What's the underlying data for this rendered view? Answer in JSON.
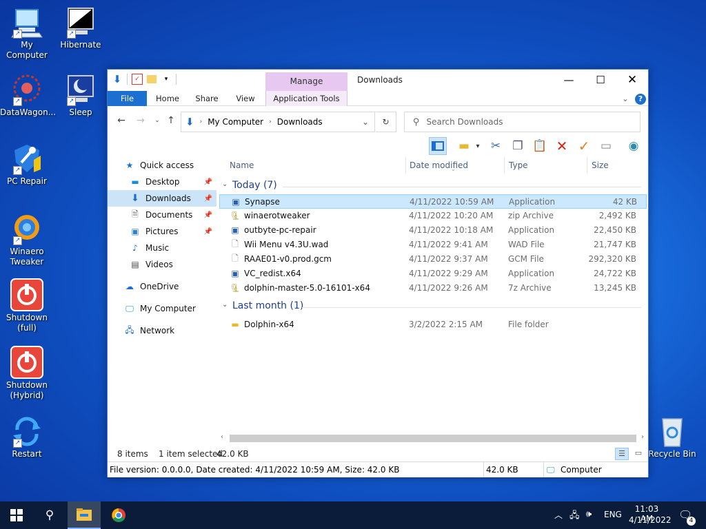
{
  "desktop": {
    "icons": [
      {
        "label": "My Computer"
      },
      {
        "label": "Hibernate"
      },
      {
        "label": "DataWagon..."
      },
      {
        "label": "Sleep"
      },
      {
        "label": "PC Repair"
      },
      {
        "label": "Winaero\nTweaker"
      },
      {
        "label": "Shutdown\n(full)"
      },
      {
        "label": "Shutdown\n(Hybrid)"
      },
      {
        "label": "Restart"
      },
      {
        "label": "Recycle Bin"
      }
    ]
  },
  "window": {
    "title": "Downloads",
    "context_tab": "Manage",
    "ribbon_tabs": [
      "File",
      "Home",
      "Share",
      "View",
      "Application Tools"
    ],
    "address": {
      "root": "My Computer",
      "current": "Downloads"
    },
    "search_placeholder": "Search Downloads"
  },
  "nav": {
    "items": [
      {
        "label": "Quick access",
        "icon": "star-icon"
      },
      {
        "label": "Desktop",
        "icon": "desktop-icon",
        "pinned": true
      },
      {
        "label": "Downloads",
        "icon": "download-icon",
        "pinned": true,
        "selected": true
      },
      {
        "label": "Documents",
        "icon": "documents-icon",
        "pinned": true
      },
      {
        "label": "Pictures",
        "icon": "pictures-icon",
        "pinned": true
      },
      {
        "label": "Music",
        "icon": "music-icon"
      },
      {
        "label": "Videos",
        "icon": "videos-icon"
      },
      {
        "label": "OneDrive",
        "icon": "cloud-icon"
      },
      {
        "label": "My Computer",
        "icon": "computer-icon"
      },
      {
        "label": "Network",
        "icon": "network-icon"
      }
    ]
  },
  "columns": {
    "name": "Name",
    "date": "Date modified",
    "type": "Type",
    "size": "Size"
  },
  "groups": [
    {
      "label": "Today (7)",
      "files": [
        {
          "name": "Synapse",
          "date": "4/11/2022 10:59 AM",
          "type": "Application",
          "size": "42 KB",
          "icon": "app-icon",
          "selected": true
        },
        {
          "name": "winaerotweaker",
          "date": "4/11/2022 10:20 AM",
          "type": "zip Archive",
          "size": "2,492 KB",
          "icon": "zip-icon"
        },
        {
          "name": "outbyte-pc-repair",
          "date": "4/11/2022 10:18 AM",
          "type": "Application",
          "size": "22,450 KB",
          "icon": "app-icon"
        },
        {
          "name": "Wii Menu v4.3U.wad",
          "date": "4/11/2022 9:41 AM",
          "type": "WAD File",
          "size": "21,747 KB",
          "icon": "file-icon"
        },
        {
          "name": "RAAE01-v0.prod.gcm",
          "date": "4/11/2022 9:37 AM",
          "type": "GCM File",
          "size": "292,320 KB",
          "icon": "file-icon"
        },
        {
          "name": "VC_redist.x64",
          "date": "4/11/2022 9:29 AM",
          "type": "Application",
          "size": "24,722 KB",
          "icon": "app-icon"
        },
        {
          "name": "dolphin-master-5.0-16101-x64",
          "date": "4/11/2022 9:26 AM",
          "type": "7z Archive",
          "size": "13,245 KB",
          "icon": "zip-icon"
        }
      ]
    },
    {
      "label": "Last month (1)",
      "files": [
        {
          "name": "Dolphin-x64",
          "date": "3/2/2022 2:15 AM",
          "type": "File folder",
          "size": "",
          "icon": "folder-icon"
        }
      ]
    }
  ],
  "status": {
    "items": "8 items",
    "selected": "1 item selected",
    "selected_size": "42.0 KB"
  },
  "info": {
    "details": "File version: 0.0.0.0, Date created: 4/11/2022 10:59 AM, Size: 42.0 KB",
    "size": "42.0 KB",
    "location": "Computer"
  },
  "taskbar": {
    "lang": "ENG",
    "time": "11:03 AM",
    "date": "4/11/2022",
    "notifications": "4"
  },
  "colors": {
    "accent": "#1a6fd0",
    "selection": "#cce8ff",
    "manage_tab": "#e6c8f0"
  }
}
